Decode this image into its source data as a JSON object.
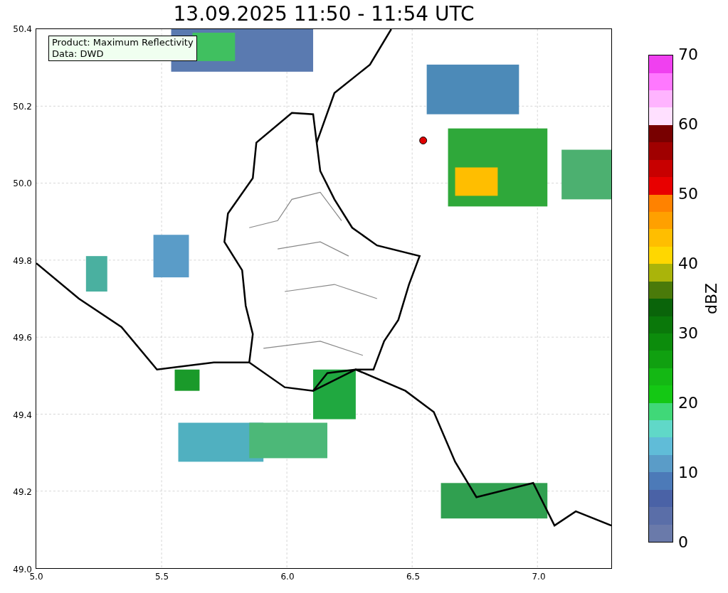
{
  "title": "13.09.2025 11:50 - 11:54 UTC",
  "legend": [
    "Product: Maximum Reflectivity",
    "Data: DWD"
  ],
  "map": {
    "yticks": [
      "50.4",
      "50.2",
      "50.0",
      "49.8",
      "49.6",
      "49.4",
      "49.2",
      "49.0"
    ],
    "xticks": [
      "5.0",
      "5.5",
      "6.0",
      "6.5",
      "7.0"
    ]
  },
  "colorbar": {
    "label": "dBZ",
    "ticks": [
      "70",
      "60",
      "50",
      "40",
      "30",
      "20",
      "10",
      "0"
    ],
    "colors": [
      {
        "color": "#6a7aaa"
      },
      {
        "color": "#5a6ea8"
      },
      {
        "color": "#4a62a6"
      },
      {
        "color": "#4c7ab8"
      },
      {
        "color": "#5a9cc8"
      },
      {
        "color": "#60bcd8"
      },
      {
        "color": "#60d8c8"
      },
      {
        "color": "#40d878"
      },
      {
        "color": "#14c814"
      },
      {
        "color": "#14b814"
      },
      {
        "color": "#10a010"
      },
      {
        "color": "#0c8c0c"
      },
      {
        "color": "#0a780a"
      },
      {
        "color": "#0a640a"
      },
      {
        "color": "#4a7a0a"
      },
      {
        "color": "#aab40a"
      },
      {
        "color": "#ffd700"
      },
      {
        "color": "#ffbe00"
      },
      {
        "color": "#ffa000"
      },
      {
        "color": "#ff8200"
      },
      {
        "color": "#e80000"
      },
      {
        "color": "#c80000"
      },
      {
        "color": "#a00000"
      },
      {
        "color": "#780000"
      },
      {
        "color": "#ffe0ff"
      },
      {
        "color": "#ffb4ff"
      },
      {
        "color": "#ff78ff"
      },
      {
        "color": "#f040f0"
      }
    ]
  }
}
